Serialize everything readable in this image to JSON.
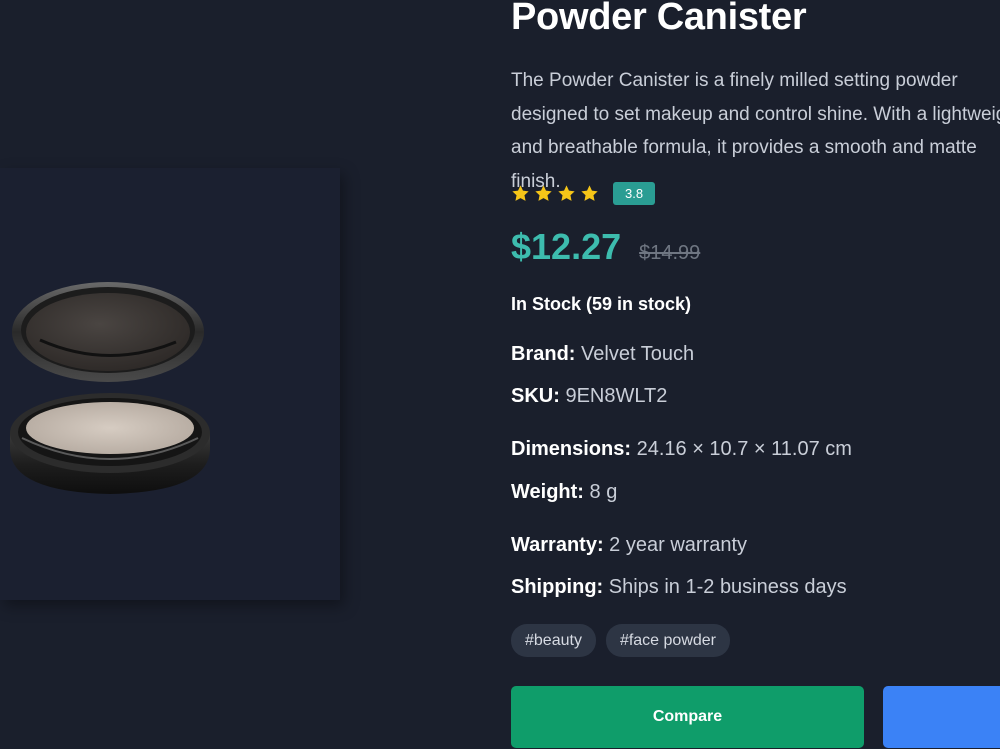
{
  "product": {
    "title": "Powder Canister",
    "description": "The Powder Canister is a finely milled setting powder designed to set makeup and control shine. With a lightweight and breathable formula, it provides a smooth and matte finish.",
    "rating": "3.8",
    "stars_shown": 4,
    "price": "$12.27",
    "original_price": "$14.99",
    "stock": "In Stock (59 in stock)"
  },
  "specs": {
    "brand_label": "Brand:",
    "brand": "Velvet Touch",
    "sku_label": "SKU:",
    "sku": "9EN8WLT2",
    "dimensions_label": "Dimensions:",
    "dimensions": "24.16 × 10.7 × 11.07 cm",
    "weight_label": "Weight:",
    "weight": "8 g",
    "warranty_label": "Warranty:",
    "warranty": "2 year warranty",
    "shipping_label": "Shipping:",
    "shipping": "Ships in 1-2 business days"
  },
  "tags": [
    "#beauty",
    "#face powder"
  ],
  "actions": {
    "compare_label": "Compare"
  },
  "colors": {
    "accent": "#3dbcae",
    "star": "#f5c518",
    "compare_button": "#0f9d6a",
    "primary_button": "#3b82f6",
    "background": "#1a1f2c"
  },
  "icons": {
    "rating": "star-icon"
  }
}
